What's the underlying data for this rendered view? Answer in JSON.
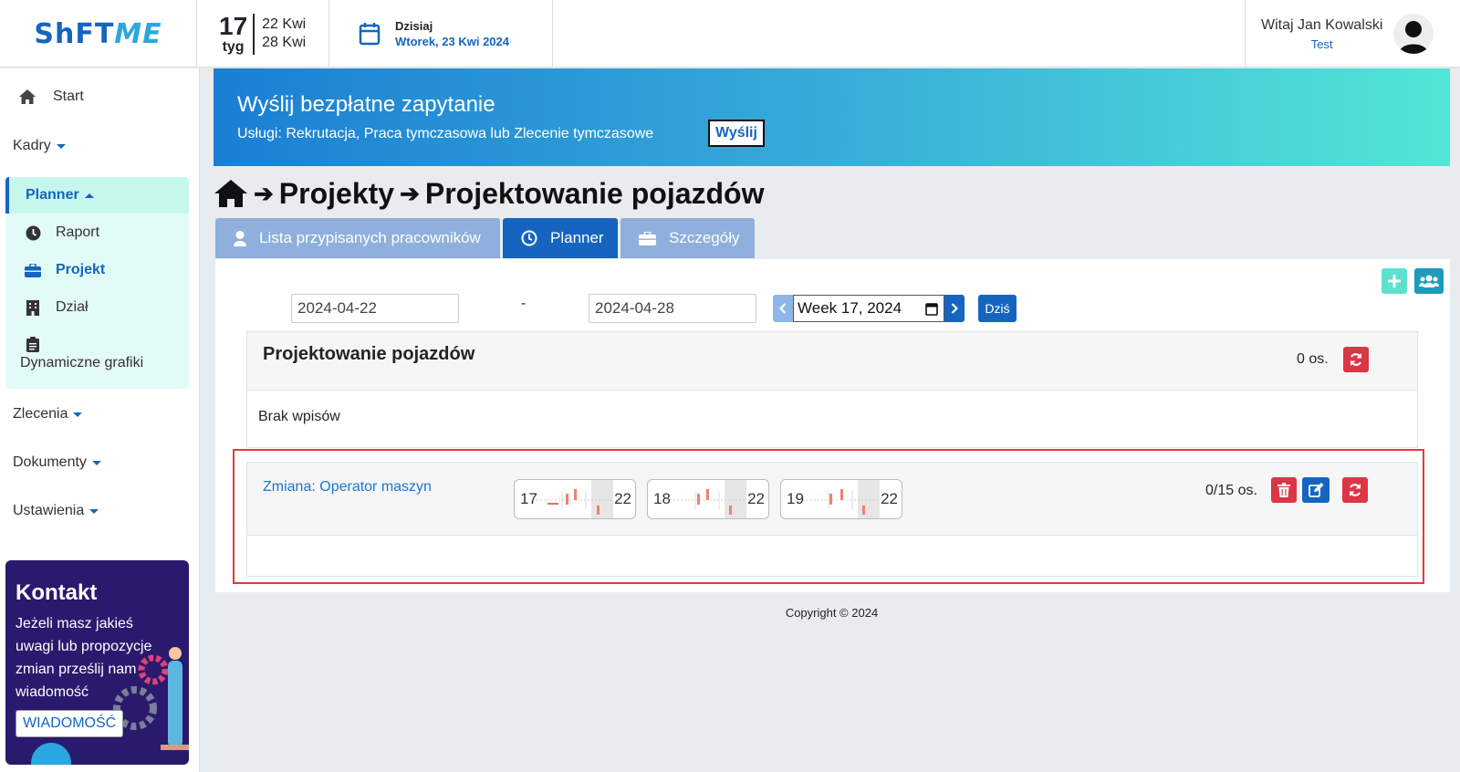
{
  "brand": {
    "logo_main": "ShFT",
    "logo_accent": "ME"
  },
  "week": {
    "number": "17",
    "unit": "tyg",
    "from": "22 Kwi",
    "to": "28 Kwi"
  },
  "today": {
    "label": "Dzisiaj",
    "date": "Wtorek, 23 Kwi 2024"
  },
  "user": {
    "greeting": "Witaj Jan Kowalski",
    "account": "Test"
  },
  "sidebar": {
    "start": "Start",
    "kadry": "Kadry",
    "planner": "Planner",
    "planner_items": [
      {
        "label": "Raport",
        "icon": "clock-icon"
      },
      {
        "label": "Projekt",
        "icon": "briefcase-icon"
      },
      {
        "label": "Dział",
        "icon": "building-icon"
      },
      {
        "label": "Dynamiczne grafiki",
        "icon": "clipboard-icon"
      }
    ],
    "zlecenia": "Zlecenia",
    "dokumenty": "Dokumenty",
    "ustawienia": "Ustawienia"
  },
  "contact": {
    "title": "Kontakt",
    "text": "Jeżeli masz jakieś uwagi lub propozycje zmian prześlij nam wiadomość",
    "button": "WIADOMOŚĆ"
  },
  "banner": {
    "title": "Wyślij bezpłatne zapytanie",
    "subtitle": "Usługi: Rekrutacja, Praca tymczasowa lub Zlecenie tymczasowe",
    "button": "Wyślij"
  },
  "breadcrumb": {
    "level1": "Projekty",
    "level2": "Projektowanie pojazdów"
  },
  "tabs": [
    {
      "label": "Lista przypisanych pracowników"
    },
    {
      "label": "Planner"
    },
    {
      "label": "Szczegóły"
    }
  ],
  "filters": {
    "date_from": "2024-04-22",
    "separator": "-",
    "date_to": "2024-04-28",
    "week": "Week 17, 2024",
    "today_button": "Dziś"
  },
  "project": {
    "title": "Projektowanie pojazdów",
    "count": "0 os.",
    "empty": "Brak wpisów"
  },
  "shift": {
    "name": "Zmiana: Operator maszyn",
    "count": "0/15 os.",
    "timelines": [
      {
        "start": "17",
        "end": "22"
      },
      {
        "start": "18",
        "end": "22"
      },
      {
        "start": "19",
        "end": "22"
      }
    ]
  },
  "footer": {
    "copyright": "Copyright © 2024"
  },
  "colors": {
    "primary": "#1565c0",
    "danger": "#dc3545",
    "accent": "#5ee0cf",
    "highlight": "#e53935"
  }
}
